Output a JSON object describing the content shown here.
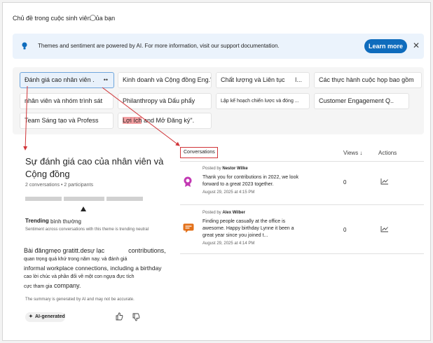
{
  "page": {
    "title": "Chủ đề trong cuộc sinh viên của bạn"
  },
  "banner": {
    "text": "Themes and sentiment are powered by AI. For more information, visit our support documentation.",
    "learn_more": "Learn more",
    "close": "✕"
  },
  "themes": [
    {
      "label": "Đánh giá cao nhân viên .",
      "more": "••",
      "selected": true
    },
    {
      "label": "Kinh doanh và Cộng đồng Eng.\""
    },
    {
      "label": "Chất lượng và Liên tục",
      "more": "I..."
    },
    {
      "label": "Các thực hành cuộc họp bao gồm"
    },
    {
      "label": "nhân viên và nhóm trình sát"
    },
    {
      "label_pre": "Ph",
      "label_rest": "ilanthropy và Dấu phẩy"
    },
    {
      "label": "Lập kế hoạch chiến lược và đóng ..."
    },
    {
      "label": "Customer Engagement Q.."
    },
    {
      "label": "Team Sáng tạo và Profess"
    },
    {
      "label_hl": "Lợi ích",
      "label_rest": "and Mở Đăng ký\"."
    }
  ],
  "summary": {
    "title": "Sự đánh giá cao của nhân viên và Cộng đồng",
    "conversations": "2 conversations",
    "sep": "•",
    "participants": "2 participants",
    "trending_label": "Trending",
    "trending_value": "bình thường",
    "trending_desc": "Sentiment across conversations with this theme is trending neutral",
    "text_line1a": "Bài đăngmẹo gratitt.desự lạc",
    "text_line1b": "contributions,",
    "text_line2": "quan trọng quá khứ trong năm nay. và đánh giá",
    "text_line3": "informal workplace connections, including a birthday",
    "text_line4": "cao lời chúc và phần đối về một con ngựa đực tích",
    "text_line5a": "cực tham gia",
    "text_line5b": "company.",
    "disclaimer": "The summary is generated by AI and may not be accurate.",
    "ai_label": "AI-generated"
  },
  "conversations": {
    "tab_label": "Conversations",
    "col_views": "Views ↓",
    "col_actions": "Actions",
    "rows": [
      {
        "posted_by": "Posted by",
        "author": "Nestor Wilke",
        "text": "Thank you for contributions in 2022, we look forward to a great 2023 together.",
        "date": "August 29, 2025 at 4:15 PM",
        "views": "0",
        "icon": "award-badge-icon",
        "icon_color": "#c239b3"
      },
      {
        "posted_by": "Posted by",
        "author": "Alex Wilber",
        "text": "Finding people casually at the office is awesome. Happy birthday Lynne it been a great year since you joined t...",
        "date": "August 29, 2025 at 4:14 PM",
        "views": "0",
        "icon": "chat-bubble-icon",
        "icon_color": "#e3711a"
      }
    ]
  },
  "colors": {
    "accent": "#0f6cbd",
    "banner_bg": "#ebf3fc",
    "annotation": "#d13438"
  }
}
